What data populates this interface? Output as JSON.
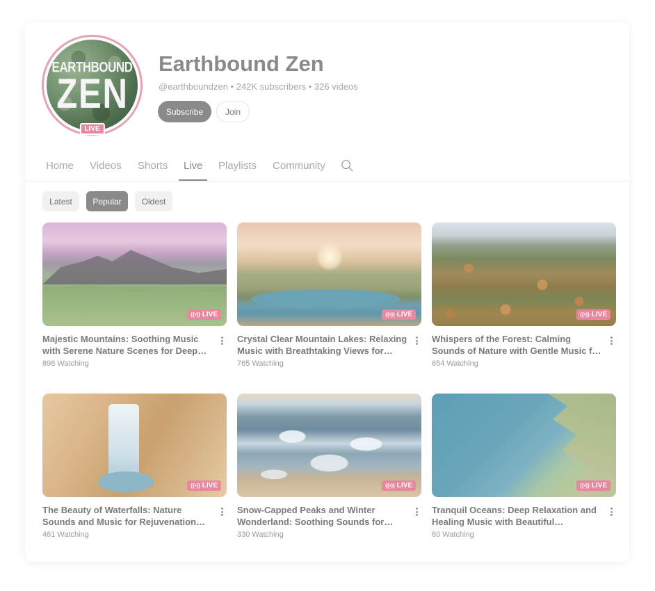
{
  "channel": {
    "avatar_top": "EARTHBOUND",
    "avatar_main": "ZEN",
    "avatar_live": "LIVE",
    "name": "Earthbound Zen",
    "meta": "@earthboundzen • 242K subscribers • 326 videos",
    "subscribe_label": "Subscribe",
    "join_label": "Join"
  },
  "tabs": [
    {
      "label": "Home",
      "active": false
    },
    {
      "label": "Videos",
      "active": false
    },
    {
      "label": "Shorts",
      "active": false
    },
    {
      "label": "Live",
      "active": true
    },
    {
      "label": "Playlists",
      "active": false
    },
    {
      "label": "Community",
      "active": false
    }
  ],
  "filters": [
    {
      "label": "Latest",
      "active": false
    },
    {
      "label": "Popular",
      "active": true
    },
    {
      "label": "Oldest",
      "active": false
    }
  ],
  "videos": [
    {
      "title": "Majestic Mountains: Soothing Music with Serene Nature Scenes for Deep Re...",
      "meta": "898 Watching",
      "badge": "LIVE"
    },
    {
      "title": "Crystal Clear Mountain Lakes: Relaxing Music with Breathtaking Views for Dee...",
      "meta": "765 Watching",
      "badge": "LIVE"
    },
    {
      "title": "Whispers of the Forest: Calming Sounds of Nature with Gentle Music for Stress...",
      "meta": "654 Watching",
      "badge": "LIVE"
    },
    {
      "title": "The Beauty of Waterfalls: Nature Sounds and Music for Rejuvenation and Peace",
      "meta": "461 Watching",
      "badge": "LIVE"
    },
    {
      "title": "Snow-Capped Peaks and Winter Wonderland: Soothing Sounds for Slee...",
      "meta": "330 Watching",
      "badge": "LIVE"
    },
    {
      "title": "Tranquil Oceans: Deep Relaxation and Healing Music with Beautiful Underwa...",
      "meta": "80 Watching",
      "badge": "LIVE"
    }
  ],
  "icons": {
    "search": "search-icon",
    "more": "more-vert-icon",
    "live": "live-broadcast-icon"
  },
  "colors": {
    "accent_live": "#e8879f",
    "subscribe_bg": "#8a8a8a",
    "avatar_ring": "#e4a2b3"
  }
}
